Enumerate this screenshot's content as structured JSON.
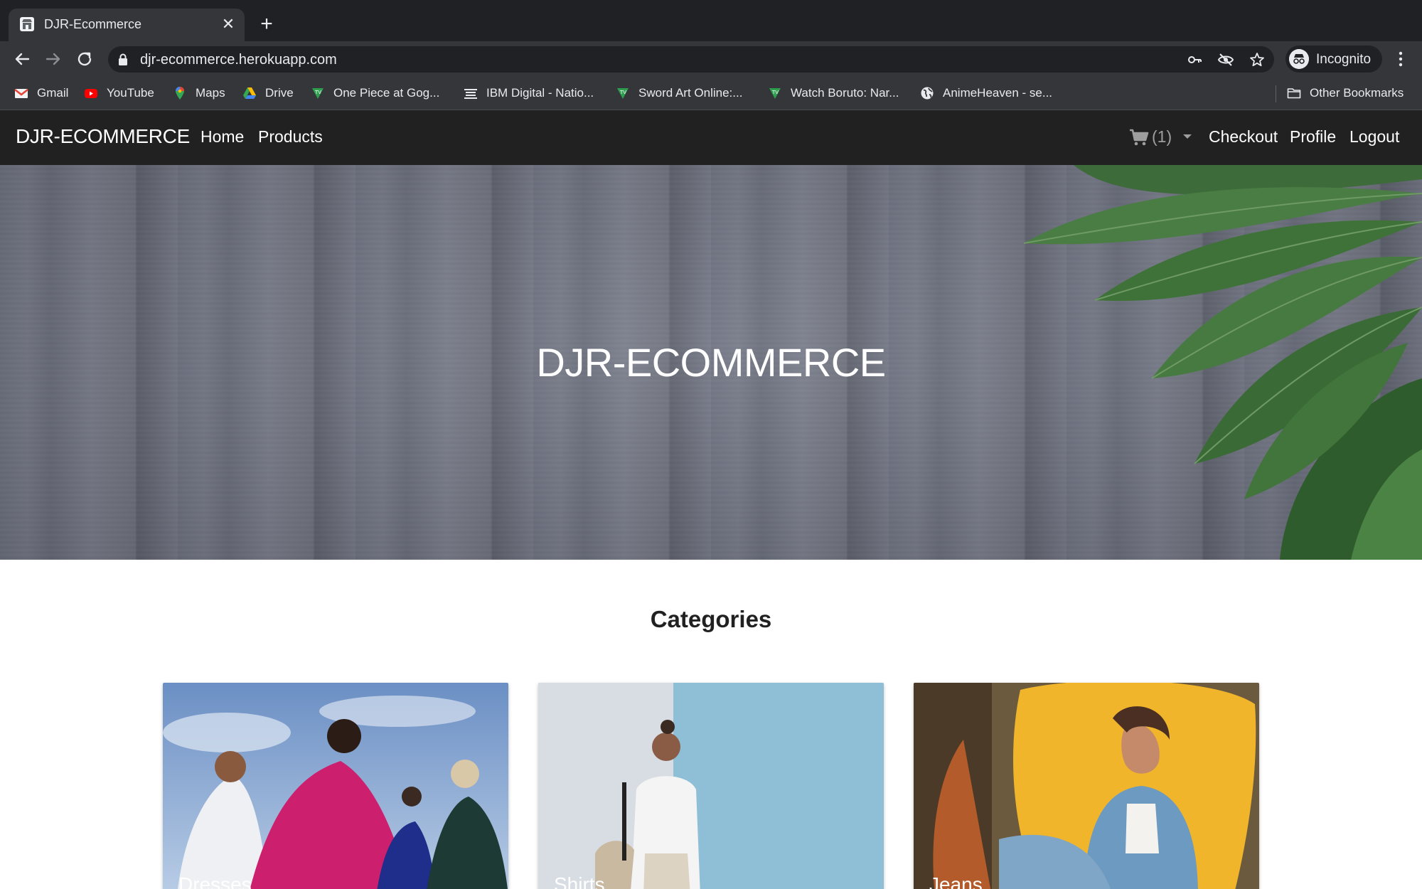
{
  "browser": {
    "tab_title": "DJR-Ecommerce",
    "url": "djr-ecommerce.herokuapp.com",
    "incognito_label": "Incognito",
    "bookmarks": [
      {
        "label": "Gmail",
        "icon": "gmail-icon"
      },
      {
        "label": "YouTube",
        "icon": "youtube-icon"
      },
      {
        "label": "Maps",
        "icon": "maps-icon"
      },
      {
        "label": "Drive",
        "icon": "drive-icon"
      },
      {
        "label": "One Piece at Gog...",
        "icon": "tv-icon"
      },
      {
        "label": "IBM Digital - Natio...",
        "icon": "ibm-icon"
      },
      {
        "label": "Sword Art Online:...",
        "icon": "tv-icon"
      },
      {
        "label": "Watch Boruto: Nar...",
        "icon": "tv-icon"
      },
      {
        "label": "AnimeHeaven - se...",
        "icon": "globe-icon"
      }
    ],
    "other_bookmarks": "Other Bookmarks"
  },
  "navbar": {
    "brand": "DJR-ECOMMERCE",
    "links": [
      "Home",
      "Products"
    ],
    "cart_count": "(1)",
    "right_links": [
      "Checkout",
      "Profile",
      "Logout"
    ]
  },
  "hero": {
    "title": "DJR-ECOMMERCE"
  },
  "categories": {
    "title": "Categories",
    "items": [
      {
        "label": "Dresses"
      },
      {
        "label": "Shirts"
      },
      {
        "label": "Jeans"
      }
    ]
  },
  "colors": {
    "navbar_bg": "#212121",
    "browser_bg": "#35363a",
    "accent_white": "#ffffff"
  }
}
